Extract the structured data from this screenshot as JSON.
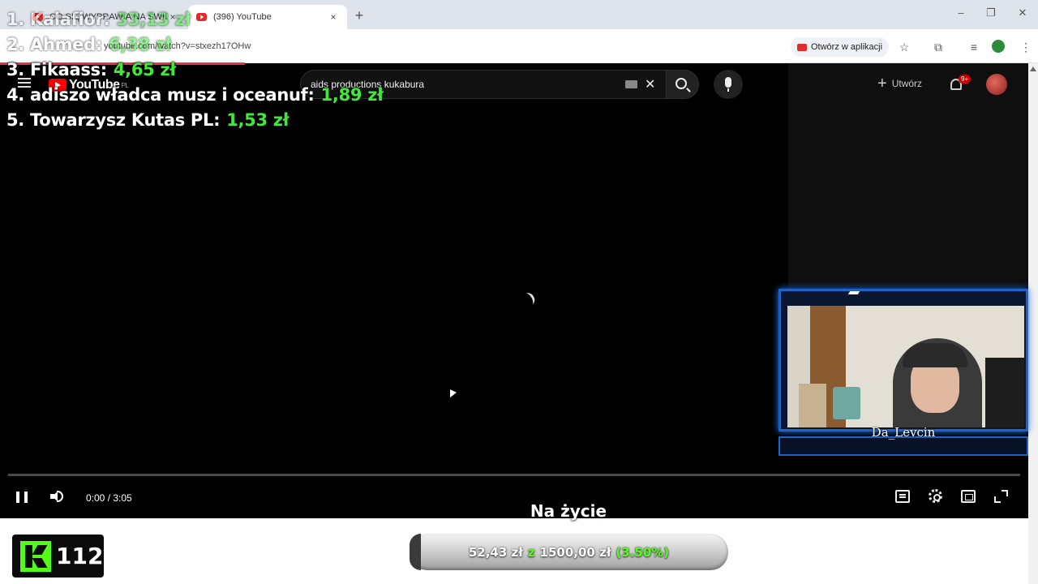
{
  "browser": {
    "tabs": [
      {
        "title": "CO SIĘ WYPRAWIA NA ŚWIECIE...",
        "active": false
      },
      {
        "title": "(396) YouTube",
        "active": true
      }
    ],
    "tab_close_label": "×",
    "new_tab_label": "+",
    "url": "youtube.com/watch?v=stxezh17OHw",
    "open_in_app_label": "Otwórz w aplikacji",
    "window_controls": {
      "minimize": "–",
      "restore": "❐",
      "close": "✕"
    }
  },
  "youtube": {
    "logo_text": "YouTube",
    "logo_region": "PL",
    "search_query": "aids productions kukabura",
    "create_label": "Utwórz",
    "notification_count": "9+",
    "player": {
      "time": "0:00 / 3:05",
      "progress": 0.0,
      "playing": true
    }
  },
  "overlay": {
    "leaderboard": [
      {
        "rank_name": "1. Kalafior:",
        "amount": "33,13 zł"
      },
      {
        "rank_name": "2. Ahmed:",
        "amount": "6,38 zł"
      },
      {
        "rank_name": "3. Fikaass:",
        "amount": "4,65 zł"
      },
      {
        "rank_name": "4. adiszo władca musz i oceanuf:",
        "amount": "1,89 zł"
      },
      {
        "rank_name": "5. Towarzysz Kutas PL:",
        "amount": "1,53 zł"
      }
    ],
    "webcam_name": "Da_Levcin",
    "now_playing": "Na życie",
    "viewer_count": "112",
    "goal": {
      "current": "52,43 zł",
      "separator": "z",
      "target": "1500,00 zł",
      "percent_label": "(3.50%)",
      "fraction": 0.035
    },
    "colors": {
      "amount_green": "#3fe83b",
      "kick_green": "#53fc18",
      "cam_border_blue": "#1c64c8"
    }
  }
}
